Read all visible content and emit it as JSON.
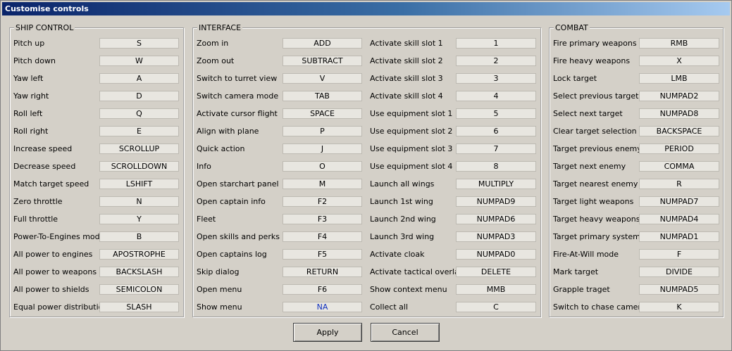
{
  "window": {
    "title": "Customise controls"
  },
  "groups": {
    "ship": {
      "title": "SHIP CONTROL",
      "rows": [
        {
          "label": "Pitch up",
          "key": "S"
        },
        {
          "label": "Pitch down",
          "key": "W"
        },
        {
          "label": "Yaw left",
          "key": "A"
        },
        {
          "label": "Yaw right",
          "key": "D"
        },
        {
          "label": "Roll left",
          "key": "Q"
        },
        {
          "label": "Roll right",
          "key": "E"
        },
        {
          "label": "Increase speed",
          "key": "SCROLLUP"
        },
        {
          "label": "Decrease speed",
          "key": "SCROLLDOWN"
        },
        {
          "label": "Match target speed",
          "key": "LSHIFT"
        },
        {
          "label": "Zero throttle",
          "key": "N"
        },
        {
          "label": "Full throttle",
          "key": "Y"
        },
        {
          "label": "Power-To-Engines mode",
          "key": "B"
        },
        {
          "label": "All power to engines",
          "key": "APOSTROPHE"
        },
        {
          "label": "All power to weapons",
          "key": "BACKSLASH"
        },
        {
          "label": "All power to shields",
          "key": "SEMICOLON"
        },
        {
          "label": "Equal power distribution",
          "key": "SLASH"
        }
      ]
    },
    "interface": {
      "title": "INTERFACE",
      "rows_left": [
        {
          "label": "Zoom in",
          "key": "ADD"
        },
        {
          "label": "Zoom out",
          "key": "SUBTRACT"
        },
        {
          "label": "Switch to turret view",
          "key": "V"
        },
        {
          "label": "Switch camera mode",
          "key": "TAB"
        },
        {
          "label": "Activate cursor flight",
          "key": "SPACE"
        },
        {
          "label": "Align with plane",
          "key": "P"
        },
        {
          "label": "Quick action",
          "key": "J"
        },
        {
          "label": "Info",
          "key": "O"
        },
        {
          "label": "Open starchart panel",
          "key": "M"
        },
        {
          "label": "Open captain info",
          "key": "F2"
        },
        {
          "label": "Fleet",
          "key": "F3"
        },
        {
          "label": "Open skills and perks",
          "key": "F4"
        },
        {
          "label": "Open captains log",
          "key": "F5"
        },
        {
          "label": "Skip dialog",
          "key": "RETURN"
        },
        {
          "label": "Open menu",
          "key": "F6"
        },
        {
          "label": "Show menu",
          "key": "NA"
        }
      ],
      "rows_right": [
        {
          "label": "Activate skill slot 1",
          "key": "1"
        },
        {
          "label": "Activate skill slot 2",
          "key": "2"
        },
        {
          "label": "Activate skill slot 3",
          "key": "3"
        },
        {
          "label": "Activate skill slot 4",
          "key": "4"
        },
        {
          "label": "Use equipment slot 1",
          "key": "5"
        },
        {
          "label": "Use equipment slot 2",
          "key": "6"
        },
        {
          "label": "Use equipment slot 3",
          "key": "7"
        },
        {
          "label": "Use equipment slot 4",
          "key": "8"
        },
        {
          "label": "Launch all wings",
          "key": "MULTIPLY"
        },
        {
          "label": "Launch 1st wing",
          "key": "NUMPAD9"
        },
        {
          "label": "Launch 2nd wing",
          "key": "NUMPAD6"
        },
        {
          "label": "Launch 3rd wing",
          "key": "NUMPAD3"
        },
        {
          "label": "Activate cloak",
          "key": "NUMPAD0"
        },
        {
          "label": "Activate tactical overlay",
          "key": "DELETE"
        },
        {
          "label": "Show context menu",
          "key": "MMB"
        },
        {
          "label": "Collect all",
          "key": "C"
        }
      ]
    },
    "combat": {
      "title": "COMBAT",
      "rows": [
        {
          "label": "Fire primary weapons",
          "key": "RMB"
        },
        {
          "label": "Fire heavy weapons",
          "key": "X"
        },
        {
          "label": "Lock target",
          "key": "LMB"
        },
        {
          "label": "Select previous target",
          "key": "NUMPAD2"
        },
        {
          "label": "Select next target",
          "key": "NUMPAD8"
        },
        {
          "label": "Clear target selection",
          "key": "BACKSPACE"
        },
        {
          "label": "Target previous enemy",
          "key": "PERIOD"
        },
        {
          "label": "Target next enemy",
          "key": "COMMA"
        },
        {
          "label": "Target nearest enemy",
          "key": "R"
        },
        {
          "label": "Target light weapons",
          "key": "NUMPAD7"
        },
        {
          "label": "Target heavy weapons",
          "key": "NUMPAD4"
        },
        {
          "label": "Target primary systems",
          "key": "NUMPAD1"
        },
        {
          "label": "Fire-At-Will mode",
          "key": "F"
        },
        {
          "label": "Mark target",
          "key": "DIVIDE"
        },
        {
          "label": "Grapple traget",
          "key": "NUMPAD5"
        },
        {
          "label": "Switch to chase camera",
          "key": "K"
        }
      ]
    }
  },
  "buttons": {
    "apply": "Apply",
    "cancel": "Cancel"
  },
  "colors": {
    "unbound_key": "#1030c0"
  }
}
